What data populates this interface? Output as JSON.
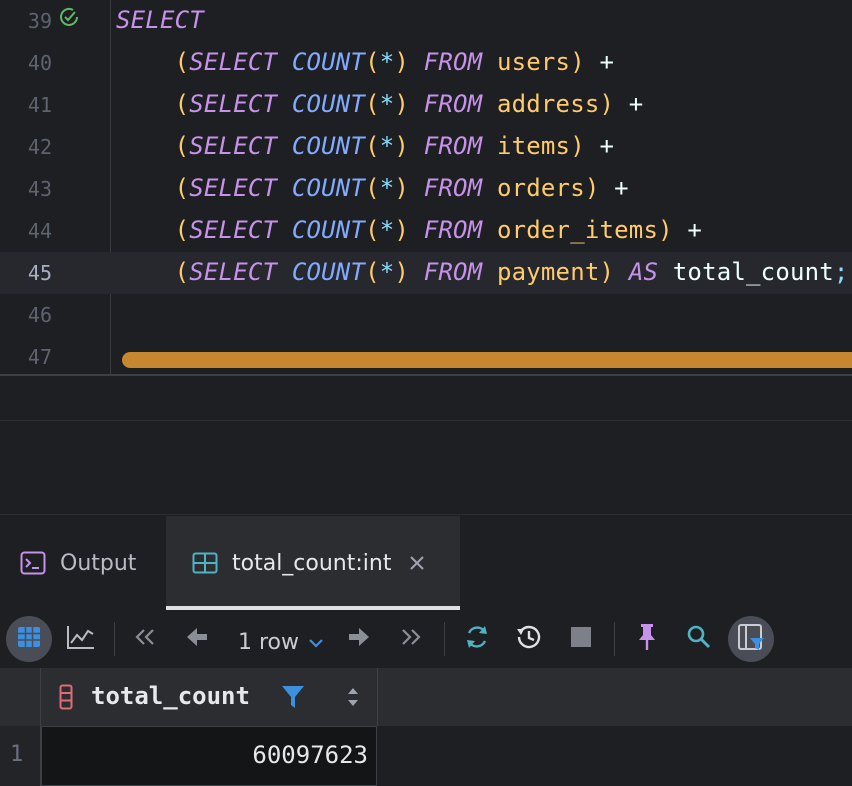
{
  "editor": {
    "lines": [
      {
        "num": "39",
        "current": false,
        "code": [
          {
            "t": "SELECT",
            "c": "kw"
          }
        ]
      },
      {
        "num": "40",
        "current": false,
        "code": [
          {
            "t": "    (",
            "c": "paren"
          },
          {
            "t": "SELECT",
            "c": "kw"
          },
          {
            "t": " ",
            "c": ""
          },
          {
            "t": "COUNT",
            "c": "fn"
          },
          {
            "t": "(",
            "c": "paren"
          },
          {
            "t": "*",
            "c": "star"
          },
          {
            "t": ")",
            "c": "paren"
          },
          {
            "t": " ",
            "c": ""
          },
          {
            "t": "FROM",
            "c": "kw"
          },
          {
            "t": " users",
            "c": "tbl"
          },
          {
            "t": ")",
            "c": "paren"
          },
          {
            "t": " +",
            "c": "op"
          }
        ]
      },
      {
        "num": "41",
        "current": false,
        "code": [
          {
            "t": "    (",
            "c": "paren"
          },
          {
            "t": "SELECT",
            "c": "kw"
          },
          {
            "t": " ",
            "c": ""
          },
          {
            "t": "COUNT",
            "c": "fn"
          },
          {
            "t": "(",
            "c": "paren"
          },
          {
            "t": "*",
            "c": "star"
          },
          {
            "t": ")",
            "c": "paren"
          },
          {
            "t": " ",
            "c": ""
          },
          {
            "t": "FROM",
            "c": "kw"
          },
          {
            "t": " address",
            "c": "tbl"
          },
          {
            "t": ")",
            "c": "paren"
          },
          {
            "t": " +",
            "c": "op"
          }
        ]
      },
      {
        "num": "42",
        "current": false,
        "code": [
          {
            "t": "    (",
            "c": "paren"
          },
          {
            "t": "SELECT",
            "c": "kw"
          },
          {
            "t": " ",
            "c": ""
          },
          {
            "t": "COUNT",
            "c": "fn"
          },
          {
            "t": "(",
            "c": "paren"
          },
          {
            "t": "*",
            "c": "star"
          },
          {
            "t": ")",
            "c": "paren"
          },
          {
            "t": " ",
            "c": ""
          },
          {
            "t": "FROM",
            "c": "kw"
          },
          {
            "t": " items",
            "c": "tbl"
          },
          {
            "t": ")",
            "c": "paren"
          },
          {
            "t": " +",
            "c": "op"
          }
        ]
      },
      {
        "num": "43",
        "current": false,
        "code": [
          {
            "t": "    (",
            "c": "paren"
          },
          {
            "t": "SELECT",
            "c": "kw"
          },
          {
            "t": " ",
            "c": ""
          },
          {
            "t": "COUNT",
            "c": "fn"
          },
          {
            "t": "(",
            "c": "paren"
          },
          {
            "t": "*",
            "c": "star"
          },
          {
            "t": ")",
            "c": "paren"
          },
          {
            "t": " ",
            "c": ""
          },
          {
            "t": "FROM",
            "c": "kw"
          },
          {
            "t": " orders",
            "c": "tbl"
          },
          {
            "t": ")",
            "c": "paren"
          },
          {
            "t": " +",
            "c": "op"
          }
        ]
      },
      {
        "num": "44",
        "current": false,
        "code": [
          {
            "t": "    (",
            "c": "paren"
          },
          {
            "t": "SELECT",
            "c": "kw"
          },
          {
            "t": " ",
            "c": ""
          },
          {
            "t": "COUNT",
            "c": "fn"
          },
          {
            "t": "(",
            "c": "paren"
          },
          {
            "t": "*",
            "c": "star"
          },
          {
            "t": ")",
            "c": "paren"
          },
          {
            "t": " ",
            "c": ""
          },
          {
            "t": "FROM",
            "c": "kw"
          },
          {
            "t": " order_items",
            "c": "tbl"
          },
          {
            "t": ")",
            "c": "paren"
          },
          {
            "t": " +",
            "c": "op"
          }
        ]
      },
      {
        "num": "45",
        "current": true,
        "code": [
          {
            "t": "    (",
            "c": "paren"
          },
          {
            "t": "SELECT",
            "c": "kw"
          },
          {
            "t": " ",
            "c": ""
          },
          {
            "t": "COUNT",
            "c": "fn"
          },
          {
            "t": "(",
            "c": "paren"
          },
          {
            "t": "*",
            "c": "star"
          },
          {
            "t": ")",
            "c": "paren"
          },
          {
            "t": " ",
            "c": ""
          },
          {
            "t": "FROM",
            "c": "kw"
          },
          {
            "t": " payment",
            "c": "tbl"
          },
          {
            "t": ")",
            "c": "paren"
          },
          {
            "t": " ",
            "c": ""
          },
          {
            "t": "AS",
            "c": "kw"
          },
          {
            "t": " total_count",
            "c": "alias"
          },
          {
            "t": ";",
            "c": "semi"
          }
        ]
      },
      {
        "num": "46",
        "current": false,
        "code": []
      },
      {
        "num": "47",
        "current": false,
        "code": []
      }
    ],
    "success_icon": "check-circle-icon",
    "scrollbar_color": "#c7872f"
  },
  "tabs": [
    {
      "label": "Output",
      "icon": "console-icon",
      "active": false
    },
    {
      "label": "total_count:int",
      "icon": "table-icon",
      "active": true,
      "close_icon": "close-icon"
    }
  ],
  "toolbar": {
    "rows_label": "1 row",
    "icons": [
      "grid-view-icon",
      "chart-view-icon",
      "first-page-icon",
      "previous-page-icon",
      "chevron-down-icon",
      "next-page-icon",
      "last-page-icon",
      "refresh-icon",
      "history-icon",
      "stop-icon",
      "pin-icon",
      "search-icon",
      "filter-view-icon"
    ]
  },
  "grid": {
    "columns": [
      {
        "name": "total_count",
        "icon": "column-icon",
        "filter_icon": "filter-icon",
        "sort_icon": "sort-icon"
      }
    ],
    "rows": [
      {
        "num": "1",
        "cells": [
          "60097623"
        ]
      }
    ]
  },
  "colors": {
    "background": "#1e1f22",
    "keyword": "#c792ea",
    "function": "#82aaff",
    "table_name": "#ffcb6b",
    "accent_blue": "#3d8fe0"
  }
}
